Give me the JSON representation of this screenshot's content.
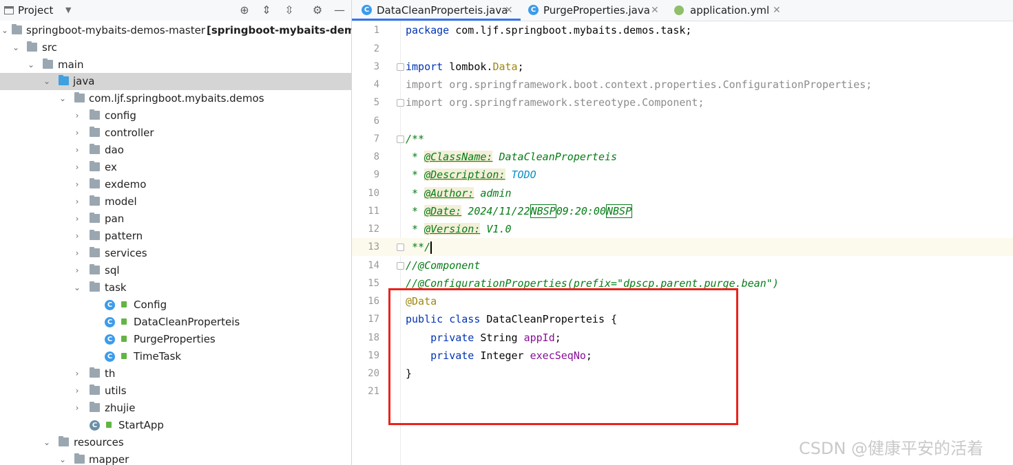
{
  "project_pane": {
    "title": "Project",
    "toolbar_icons": [
      "locate-icon",
      "expand-all-icon",
      "collapse-all-icon",
      "gear-icon",
      "minimize-icon"
    ],
    "tree": [
      {
        "label": "springboot-mybaits-demos-master",
        "suffix": "[springboot-mybaits-demos",
        "kind": "module",
        "expanded": true
      },
      {
        "label": "src",
        "kind": "folder",
        "expanded": true
      },
      {
        "label": "main",
        "kind": "folder",
        "expanded": true
      },
      {
        "label": "java",
        "kind": "source-folder",
        "expanded": true,
        "selected": true
      },
      {
        "label": "com.ljf.springboot.mybaits.demos",
        "kind": "package",
        "expanded": true
      },
      {
        "label": "config",
        "kind": "package",
        "expanded": false
      },
      {
        "label": "controller",
        "kind": "package",
        "expanded": false
      },
      {
        "label": "dao",
        "kind": "package",
        "expanded": false
      },
      {
        "label": "ex",
        "kind": "package",
        "expanded": false
      },
      {
        "label": "exdemo",
        "kind": "package",
        "expanded": false
      },
      {
        "label": "model",
        "kind": "package",
        "expanded": false
      },
      {
        "label": "pan",
        "kind": "package",
        "expanded": false
      },
      {
        "label": "pattern",
        "kind": "package",
        "expanded": false
      },
      {
        "label": "services",
        "kind": "package",
        "expanded": false
      },
      {
        "label": "sql",
        "kind": "package",
        "expanded": false
      },
      {
        "label": "task",
        "kind": "package",
        "expanded": true
      },
      {
        "label": "Config",
        "kind": "class"
      },
      {
        "label": "DataCleanProperteis",
        "kind": "class"
      },
      {
        "label": "PurgeProperties",
        "kind": "class"
      },
      {
        "label": "TimeTask",
        "kind": "class"
      },
      {
        "label": "th",
        "kind": "package",
        "expanded": false
      },
      {
        "label": "utils",
        "kind": "package",
        "expanded": false
      },
      {
        "label": "zhujie",
        "kind": "package",
        "expanded": false
      },
      {
        "label": "StartApp",
        "kind": "spring-class"
      },
      {
        "label": "resources",
        "kind": "resources-folder",
        "expanded": true
      },
      {
        "label": "mapper",
        "kind": "folder",
        "expanded": true
      }
    ]
  },
  "editor": {
    "tabs": [
      {
        "label": "DataCleanProperteis.java",
        "active": true,
        "icon": "class-icon"
      },
      {
        "label": "PurgeProperties.java",
        "active": false,
        "icon": "class-icon"
      },
      {
        "label": "application.yml",
        "active": false,
        "icon": "yaml-icon"
      }
    ],
    "current_line": 13,
    "lines": [
      {
        "n": "1",
        "text": "package com.ljf.springboot.mybaits.demos.task;"
      },
      {
        "n": "2",
        "text": ""
      },
      {
        "n": "3",
        "text": "import lombok.Data;"
      },
      {
        "n": "4",
        "text": "import org.springframework.boot.context.properties.ConfigurationProperties;"
      },
      {
        "n": "5",
        "text": "import org.springframework.stereotype.Component;"
      },
      {
        "n": "6",
        "text": ""
      },
      {
        "n": "7",
        "text": "/**"
      },
      {
        "n": "8",
        "text": " * @ClassName: DataCleanProperteis"
      },
      {
        "n": "9",
        "text": " * @Description: TODO"
      },
      {
        "n": "10",
        "text": " * @Author: admin"
      },
      {
        "n": "11",
        "text": " * @Date: 2024/11/22NBSP09:20:00NBSP"
      },
      {
        "n": "12",
        "text": " * @Version: V1.0"
      },
      {
        "n": "13",
        "text": " **/"
      },
      {
        "n": "14",
        "text": "//@Component"
      },
      {
        "n": "15",
        "text": "//@ConfigurationProperties(prefix=\"dpscp.parent.purge.bean\")"
      },
      {
        "n": "16",
        "text": "@Data"
      },
      {
        "n": "17",
        "text": "public class DataCleanProperteis {"
      },
      {
        "n": "18",
        "text": "    private String appId;"
      },
      {
        "n": "19",
        "text": "    private Integer execSeqNo;"
      },
      {
        "n": "20",
        "text": "}"
      },
      {
        "n": "21",
        "text": ""
      }
    ],
    "tokens": {
      "l1_kw": "package",
      "l1_rest": " com.ljf.springboot.mybaits.demos.task;",
      "l3_kw": "import",
      "l3_a": " lombok.",
      "l3_b": "Data",
      "l3_c": ";",
      "l4": "import org.springframework.boot.context.properties.ConfigurationProperties;",
      "l5": "import org.springframework.stereotype.Component;",
      "l7": "/**",
      "l8_pre": " * ",
      "l8_tag": "@ClassName:",
      "l8_val": " DataCleanProperteis",
      "l9_pre": " * ",
      "l9_tag": "@Description:",
      "l9_val": " TODO",
      "l10_pre": " * ",
      "l10_tag": "@Author:",
      "l10_val": " admin",
      "l11_pre": " * ",
      "l11_tag": "@Date:",
      "l11_a": " 2024/11/22",
      "l11_b": "NBSP",
      "l11_c": "09:20:00",
      "l11_d": "NBSP",
      "l12_pre": " * ",
      "l12_tag": "@Version:",
      "l12_val": " V1.0",
      "l13": " **/",
      "l14": "//@Component",
      "l15": "//@ConfigurationProperties(prefix=\"dpscp.parent.purge.bean\")",
      "l16": "@Data",
      "l17_kw": "public class",
      "l17_rest": " DataCleanProperteis {",
      "l18_ind": "    ",
      "l18_kw": "private",
      "l18_type": " String ",
      "l18_field": "appId",
      "l18_end": ";",
      "l19_ind": "    ",
      "l19_kw": "private",
      "l19_type": " Integer ",
      "l19_field": "execSeqNo",
      "l19_end": ";",
      "l20": "}"
    }
  },
  "watermark": "CSDN @健康平安的活着",
  "colors": {
    "highlight_box": "#e8231b",
    "keyword": "#0033b3",
    "doc_comment": "#067d17",
    "annotation": "#9e880d",
    "field": "#871094"
  }
}
